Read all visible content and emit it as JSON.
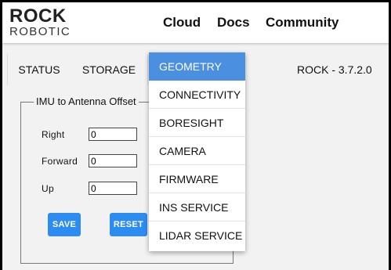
{
  "header": {
    "logo_top": "ROCK",
    "logo_bottom": "ROBOTIC",
    "nav": [
      "Cloud",
      "Docs",
      "Community"
    ]
  },
  "tabs": [
    "STATUS",
    "STORAGE"
  ],
  "version": "ROCK - 3.7.2.0",
  "panel": {
    "title": "IMU to Antenna Offset",
    "fields": [
      {
        "label": "Right",
        "value": "0"
      },
      {
        "label": "Forward",
        "value": "0"
      },
      {
        "label": "Up",
        "value": "0"
      }
    ],
    "save_label": "SAVE",
    "reset_label": "RESET"
  },
  "menu": {
    "items": [
      "GEOMETRY",
      "CONNECTIVITY",
      "BORESIGHT",
      "CAMERA",
      "FIRMWARE",
      "INS SERVICE",
      "LIDAR SERVICE"
    ],
    "selected": "GEOMETRY"
  },
  "colors": {
    "accent": "#4a8fe0",
    "button": "#2d8cf0"
  }
}
